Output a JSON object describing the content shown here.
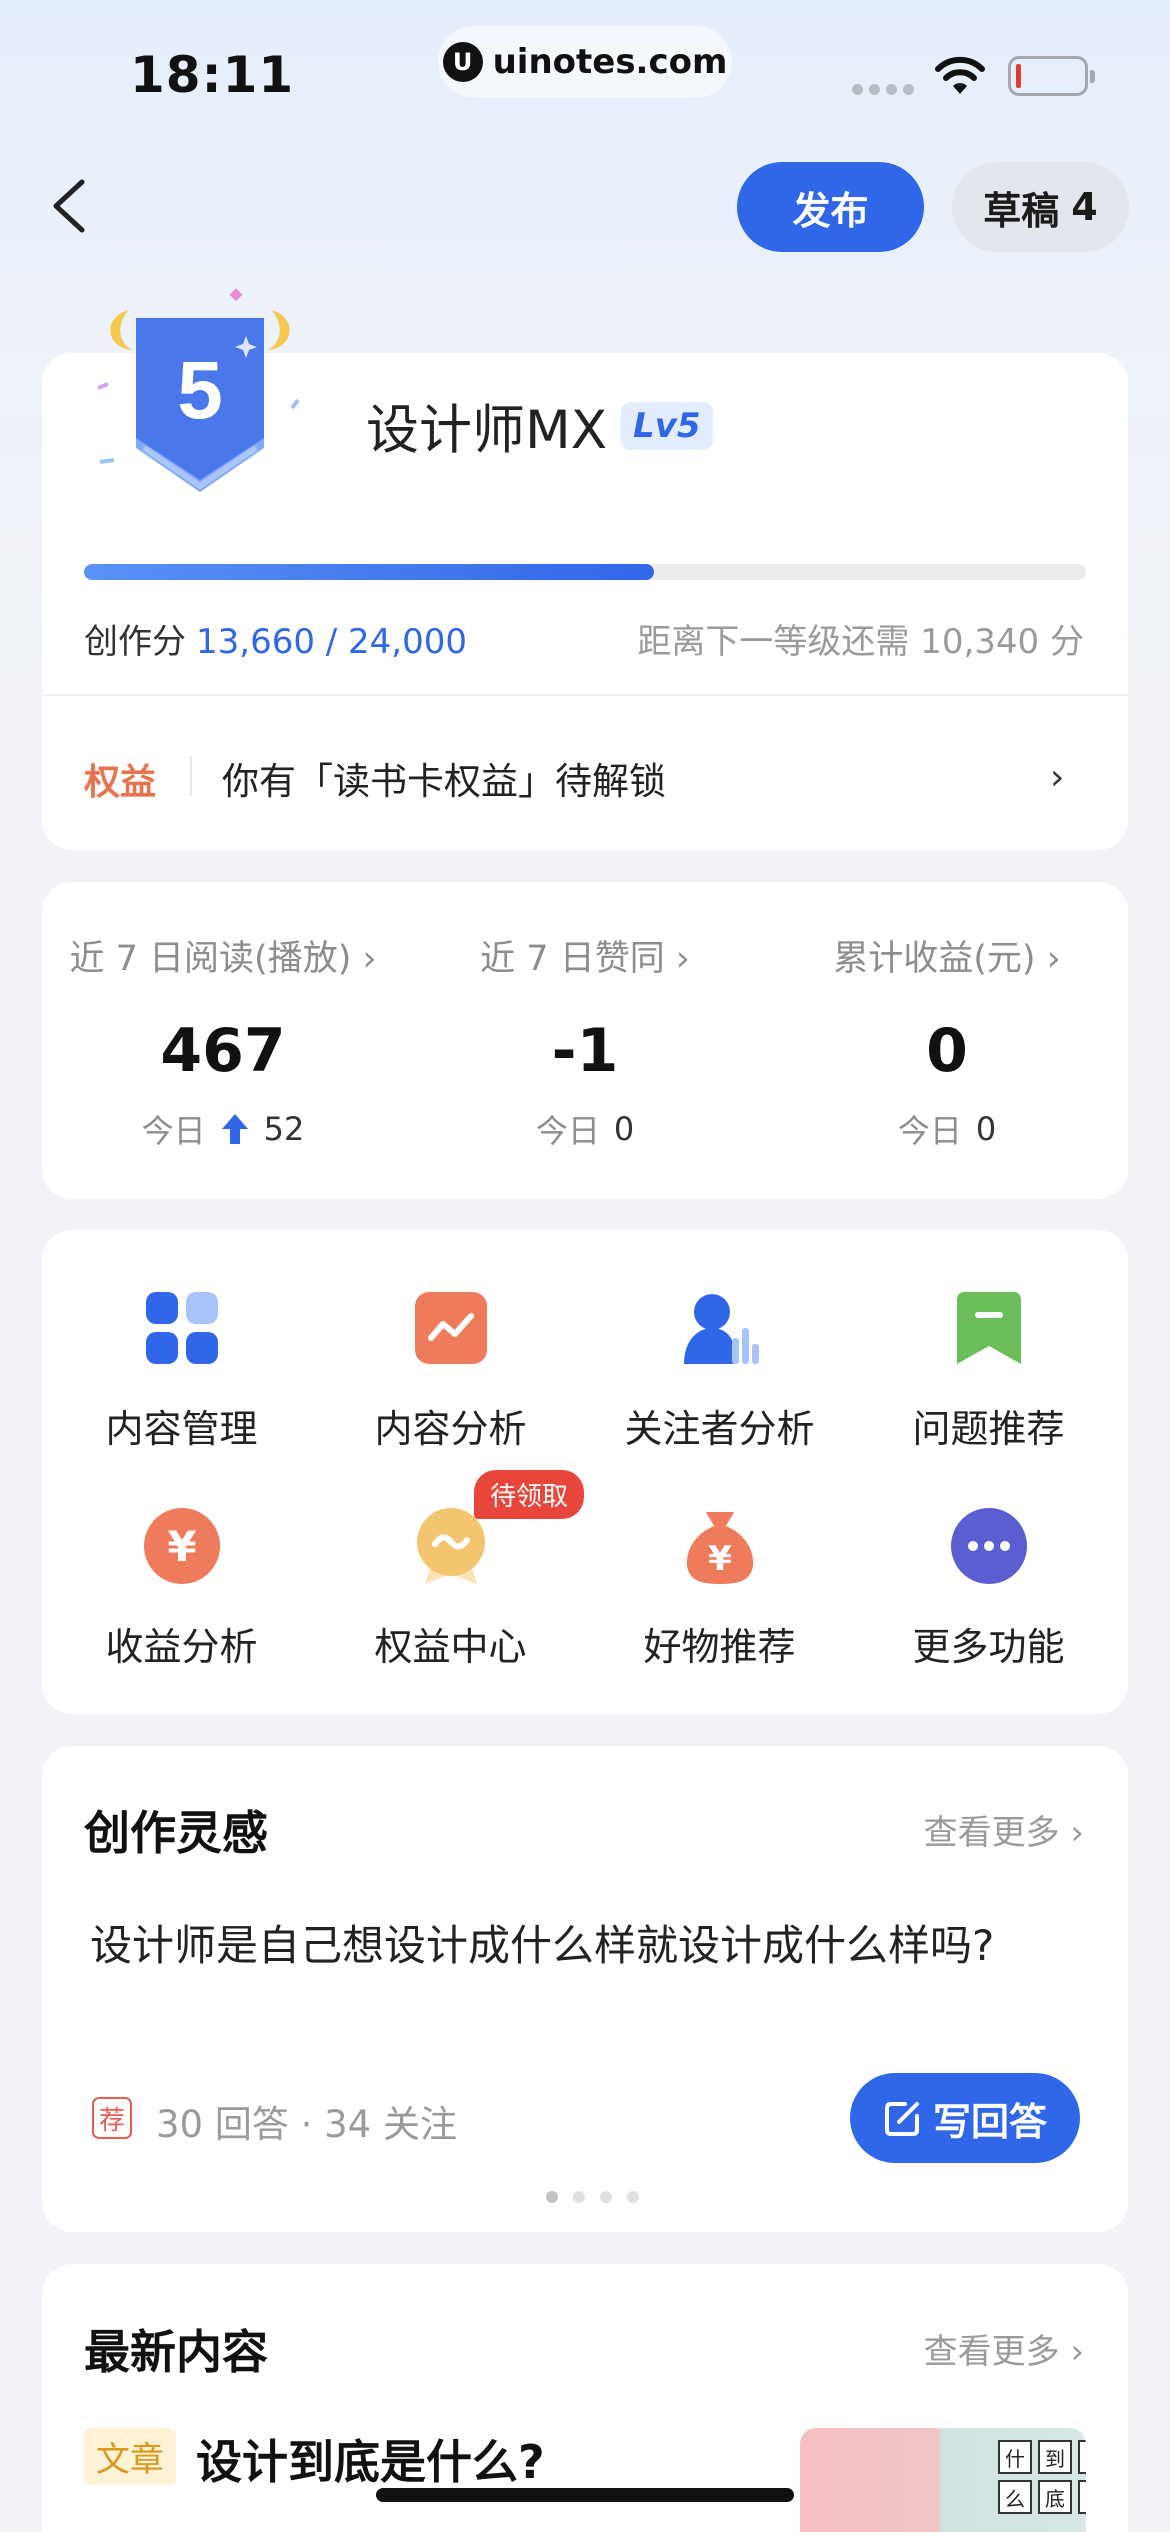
{
  "status_bar": {
    "time": "18:11",
    "url": "uinotes.com",
    "url_logo": "U"
  },
  "nav": {
    "publish_label": "发布",
    "drafts_label": "草稿",
    "drafts_count": "4"
  },
  "profile": {
    "badge_level": "5",
    "username": "设计师MX",
    "level_tag": "Lv5",
    "progress_fraction": 0.5692,
    "score_label": "创作分",
    "score_value": "13,660 / 24,000",
    "next_level_text": "距离下一等级还需 10,340 分",
    "benefit_label": "权益",
    "benefit_text": "你有「读书卡权益」待解锁",
    "benefit_arrow": "›"
  },
  "stats": [
    {
      "label": "近 7 日阅读(播放) ›",
      "value": "467",
      "today_label": "今日",
      "today_value": "52",
      "trend": "up"
    },
    {
      "label": "近 7 日赞同 ›",
      "value": "-1",
      "today_label": "今日",
      "today_value": "0"
    },
    {
      "label": "累计收益(元) ›",
      "value": "0",
      "today_label": "今日",
      "today_value": "0"
    }
  ],
  "tools": [
    {
      "label": "内容管理",
      "icon": "grid-icon"
    },
    {
      "label": "内容分析",
      "icon": "trend-chart-icon"
    },
    {
      "label": "关注者分析",
      "icon": "follower-chart-icon"
    },
    {
      "label": "问题推荐",
      "icon": "bookmark-icon"
    },
    {
      "label": "收益分析",
      "icon": "yuan-coin-icon"
    },
    {
      "label": "权益中心",
      "icon": "medal-icon"
    },
    {
      "label": "好物推荐",
      "icon": "money-bag-icon"
    },
    {
      "label": "更多功能",
      "icon": "more-dots-icon"
    }
  ],
  "pending_badge": "待领取",
  "inspiration": {
    "title": "创作灵感",
    "more": "查看更多 ›",
    "question": "设计师是自己想设计成什么样就设计成什么样吗?",
    "rec_tag": "荐",
    "meta": "30 回答 · 34 关注",
    "write_label": "写回答"
  },
  "latest": {
    "title": "最新内容",
    "more": "查看更多 ›",
    "article_tag": "文章",
    "article_title": "设计到底是什么?",
    "thumb_chars": [
      "什",
      "到",
      "",
      "么",
      "底",
      "",
      "",
      "",
      ""
    ]
  },
  "colors": {
    "accent": "#2f67e8",
    "benefit": "#e8734e",
    "badge_red": "#e8463a"
  }
}
